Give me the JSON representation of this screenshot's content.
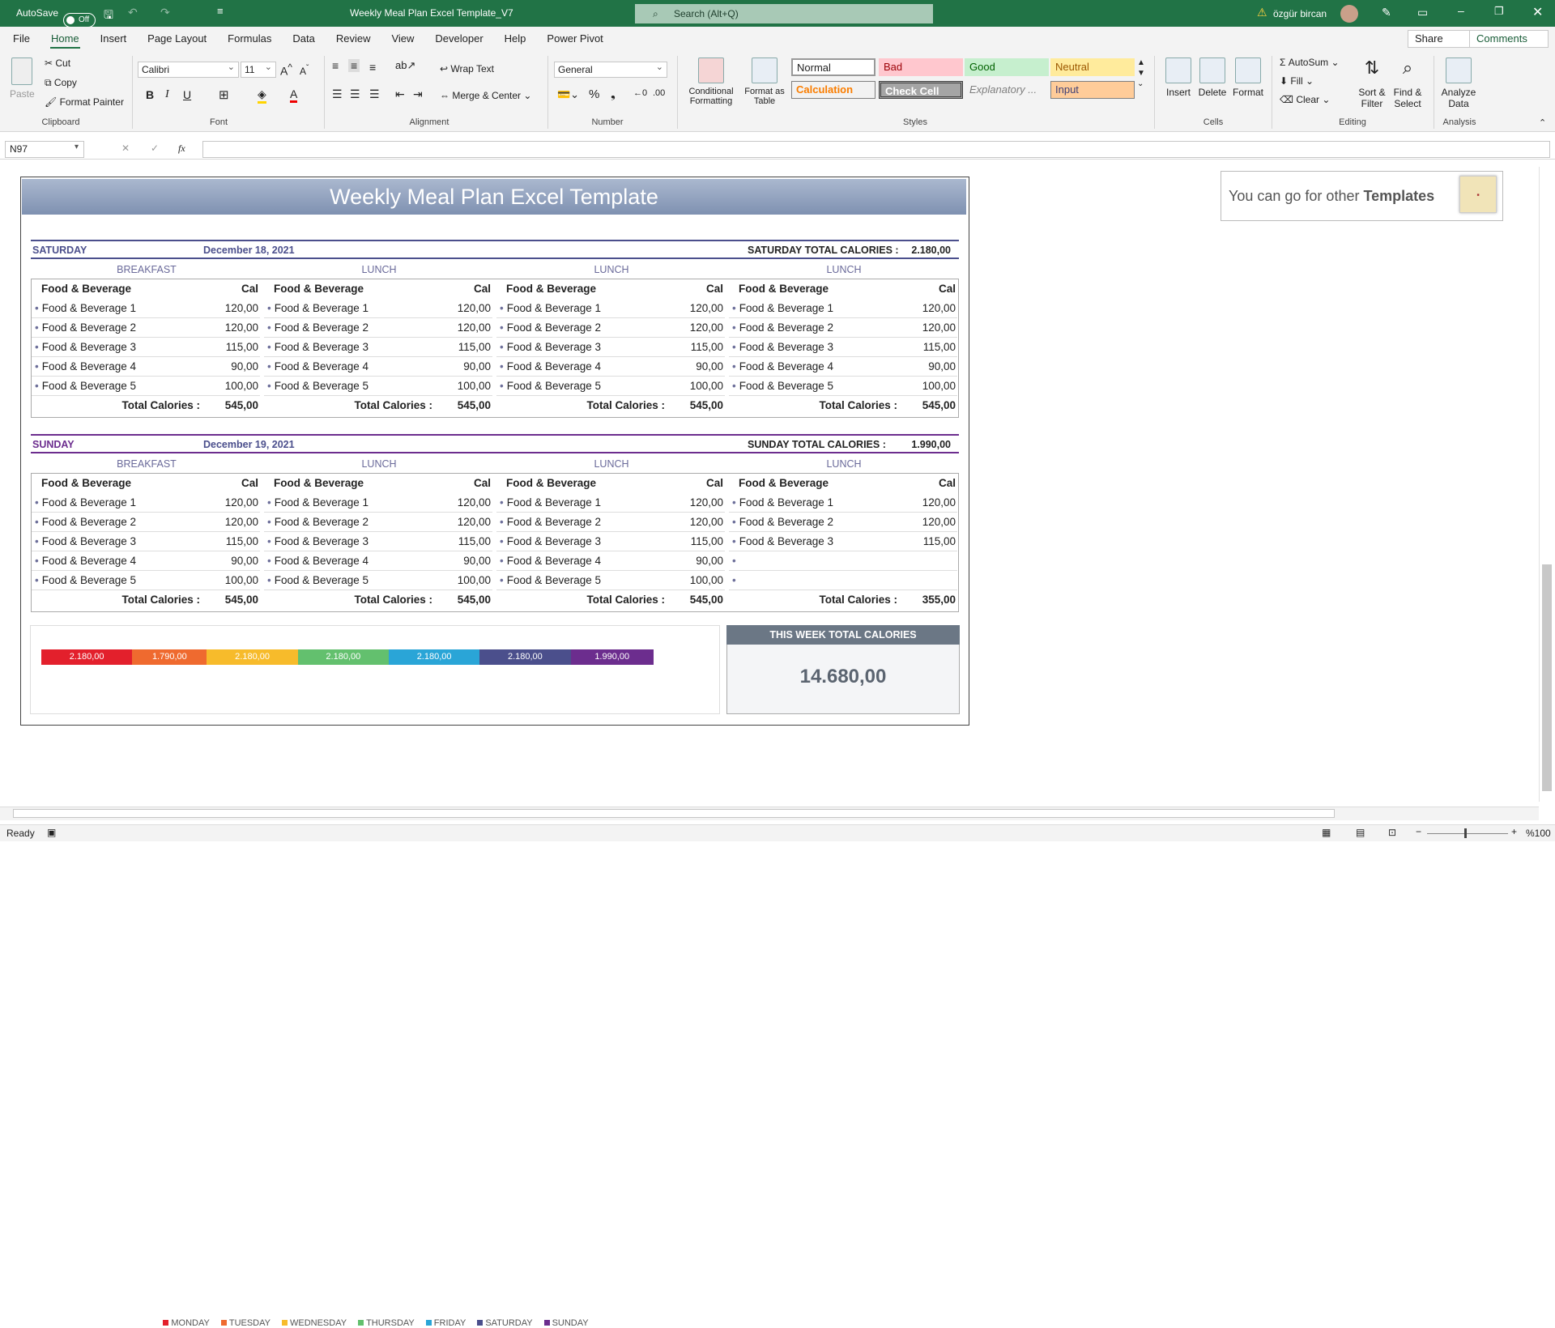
{
  "titlebar": {
    "autosave": "AutoSave",
    "toggle": "Off",
    "doc_title": "Weekly Meal Plan Excel Template_V7",
    "search_placeholder": "Search (Alt+Q)",
    "user": "özgür bircan"
  },
  "menu": [
    "File",
    "Home",
    "Insert",
    "Page Layout",
    "Formulas",
    "Data",
    "Review",
    "View",
    "Developer",
    "Help",
    "Power Pivot"
  ],
  "menu_right": {
    "share": "Share",
    "comments": "Comments"
  },
  "ribbon": {
    "clipboard": {
      "paste": "Paste",
      "cut": "Cut",
      "copy": "Copy",
      "format_painter": "Format Painter",
      "label": "Clipboard"
    },
    "font": {
      "name": "Calibri",
      "size": "11",
      "label": "Font"
    },
    "alignment": {
      "wrap": "Wrap Text",
      "merge": "Merge & Center",
      "label": "Alignment"
    },
    "number": {
      "format": "General",
      "label": "Number"
    },
    "styles": {
      "cond": "Conditional Formatting",
      "fmt_table": "Format as Table",
      "normal": "Normal",
      "bad": "Bad",
      "good": "Good",
      "neutral": "Neutral",
      "calculation": "Calculation",
      "check": "Check Cell",
      "explanatory": "Explanatory ...",
      "input": "Input",
      "label": "Styles"
    },
    "cells": {
      "insert": "Insert",
      "delete": "Delete",
      "format": "Format",
      "label": "Cells"
    },
    "editing": {
      "autosum": "AutoSum",
      "fill": "Fill",
      "clear": "Clear",
      "sort": "Sort & Filter",
      "find": "Find & Select",
      "label": "Editing"
    },
    "analysis": {
      "analyze": "Analyze Data",
      "label": "Analysis"
    }
  },
  "formula": {
    "namebox": "N97",
    "fx": "fx"
  },
  "sheet": {
    "banner": "Weekly Meal Plan Excel Template",
    "other_prefix": "You can go for other ",
    "other_bold": "Templates",
    "days": [
      {
        "day": "SATURDAY",
        "date": "December 18, 2021",
        "total_label": "SATURDAY TOTAL CALORIES :",
        "total": "2.180,00",
        "color": "#4b4f8c",
        "meals": [
          "BREAKFAST",
          "LUNCH",
          "LUNCH",
          "LUNCH"
        ],
        "columns": [
          {
            "items": [
              [
                "Food & Beverage 1",
                "120,00"
              ],
              [
                "Food & Beverage 2",
                "120,00"
              ],
              [
                "Food & Beverage 3",
                "115,00"
              ],
              [
                "Food & Beverage 4",
                "90,00"
              ],
              [
                "Food & Beverage 5",
                "100,00"
              ]
            ],
            "total": "545,00"
          },
          {
            "items": [
              [
                "Food & Beverage 1",
                "120,00"
              ],
              [
                "Food & Beverage 2",
                "120,00"
              ],
              [
                "Food & Beverage 3",
                "115,00"
              ],
              [
                "Food & Beverage 4",
                "90,00"
              ],
              [
                "Food & Beverage 5",
                "100,00"
              ]
            ],
            "total": "545,00"
          },
          {
            "items": [
              [
                "Food & Beverage 1",
                "120,00"
              ],
              [
                "Food & Beverage 2",
                "120,00"
              ],
              [
                "Food & Beverage 3",
                "115,00"
              ],
              [
                "Food & Beverage 4",
                "90,00"
              ],
              [
                "Food & Beverage 5",
                "100,00"
              ]
            ],
            "total": "545,00"
          },
          {
            "items": [
              [
                "Food & Beverage 1",
                "120,00"
              ],
              [
                "Food & Beverage 2",
                "120,00"
              ],
              [
                "Food & Beverage 3",
                "115,00"
              ],
              [
                "Food & Beverage 4",
                "90,00"
              ],
              [
                "Food & Beverage 5",
                "100,00"
              ]
            ],
            "total": "545,00"
          }
        ]
      },
      {
        "day": "SUNDAY",
        "date": "December 19, 2021",
        "total_label": "SUNDAY TOTAL CALORIES :",
        "total": "1.990,00",
        "color": "#6c2d8e",
        "meals": [
          "BREAKFAST",
          "LUNCH",
          "LUNCH",
          "LUNCH"
        ],
        "columns": [
          {
            "items": [
              [
                "Food & Beverage 1",
                "120,00"
              ],
              [
                "Food & Beverage 2",
                "120,00"
              ],
              [
                "Food & Beverage 3",
                "115,00"
              ],
              [
                "Food & Beverage 4",
                "90,00"
              ],
              [
                "Food & Beverage 5",
                "100,00"
              ]
            ],
            "total": "545,00"
          },
          {
            "items": [
              [
                "Food & Beverage 1",
                "120,00"
              ],
              [
                "Food & Beverage 2",
                "120,00"
              ],
              [
                "Food & Beverage 3",
                "115,00"
              ],
              [
                "Food & Beverage 4",
                "90,00"
              ],
              [
                "Food & Beverage 5",
                "100,00"
              ]
            ],
            "total": "545,00"
          },
          {
            "items": [
              [
                "Food & Beverage 1",
                "120,00"
              ],
              [
                "Food & Beverage 2",
                "120,00"
              ],
              [
                "Food & Beverage 3",
                "115,00"
              ],
              [
                "Food & Beverage 4",
                "90,00"
              ],
              [
                "Food & Beverage 5",
                "100,00"
              ]
            ],
            "total": "545,00"
          },
          {
            "items": [
              [
                "Food & Beverage 1",
                "120,00"
              ],
              [
                "Food & Beverage 2",
                "120,00"
              ],
              [
                "Food & Beverage 3",
                "115,00"
              ],
              [
                "",
                ""
              ],
              [
                "",
                ""
              ]
            ],
            "total": "355,00"
          }
        ]
      }
    ],
    "col_header": {
      "fb": "Food & Beverage",
      "cal": "Cal",
      "total": "Total Calories :"
    },
    "week_title": "THIS WEEK TOTAL CALORIES",
    "week_total": "14.680,00"
  },
  "chart_data": {
    "type": "bar",
    "orientation": "horizontal-stacked",
    "categories": [
      "MONDAY",
      "TUESDAY",
      "WEDNESDAY",
      "THURSDAY",
      "FRIDAY",
      "SATURDAY",
      "SUNDAY"
    ],
    "values": [
      2180,
      1790,
      2180,
      2180,
      2180,
      2180,
      1990
    ],
    "labels": [
      "2.180,00",
      "1.790,00",
      "2.180,00",
      "2.180,00",
      "2.180,00",
      "2.180,00",
      "1.990,00"
    ],
    "colors": [
      "#e3202c",
      "#ef6a2f",
      "#f7bb2b",
      "#63c06e",
      "#2aa5d7",
      "#4b4f8c",
      "#6c2d8e"
    ],
    "legend": "bottom"
  },
  "status": {
    "ready": "Ready",
    "zoom": "%100"
  }
}
